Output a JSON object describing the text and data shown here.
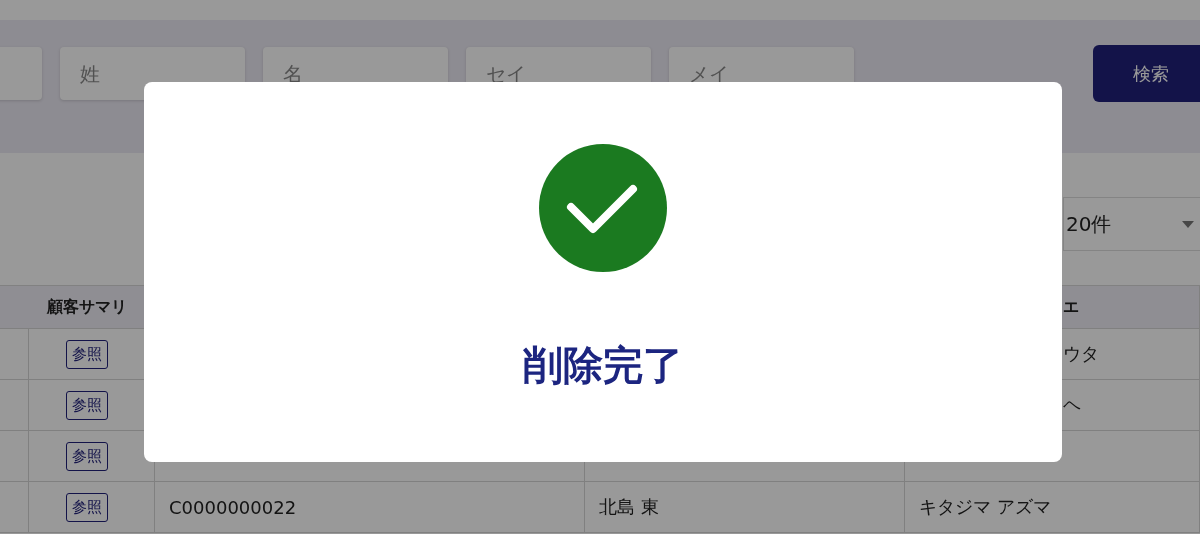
{
  "search": {
    "fields": [
      {
        "placeholder": "姓"
      },
      {
        "placeholder": "名"
      },
      {
        "placeholder": "セイ"
      },
      {
        "placeholder": "メイ"
      }
    ],
    "button": "検索"
  },
  "page_size": {
    "value": "20件"
  },
  "table": {
    "summary_heading": "顧客サマリ",
    "column_4_heading": "エ",
    "column_4_heading_cut": true,
    "rows": [
      {
        "button": "参照",
        "kana": "ウタ",
        "kana_cut": true
      },
      {
        "button": "参照",
        "kana": "ヘ",
        "kana_cut": true
      },
      {
        "button": "参照"
      },
      {
        "button": "参照",
        "customer_id": "C0000000022",
        "name": "北島 東",
        "kana": "キタジマ アズマ",
        "kana_cut": false
      }
    ]
  },
  "dialog": {
    "kind": "success",
    "message": "削除完了"
  }
}
